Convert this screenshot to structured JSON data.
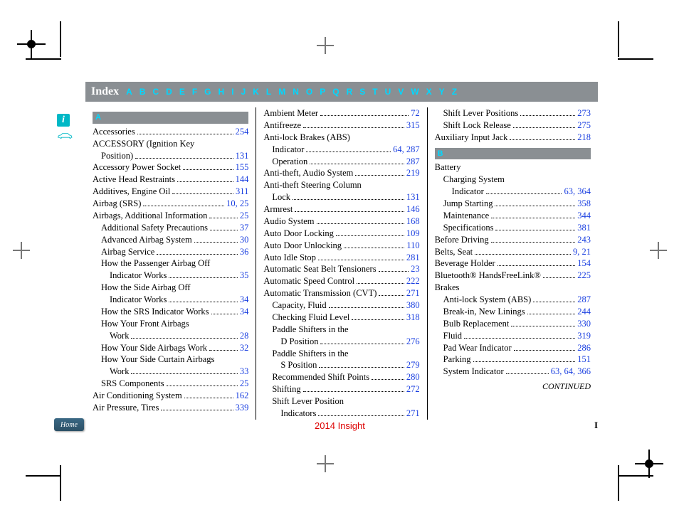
{
  "header": {
    "title": "Index",
    "letters": [
      "A",
      "B",
      "C",
      "D",
      "E",
      "F",
      "G",
      "H",
      "I",
      "J",
      "K",
      "L",
      "M",
      "N",
      "O",
      "P",
      "Q",
      "R",
      "S",
      "T",
      "U",
      "V",
      "W",
      "X",
      "Y",
      "Z"
    ]
  },
  "footer": {
    "center": "2014 Insight",
    "pageno": "I"
  },
  "side": {
    "info": "i",
    "home": "Home"
  },
  "continued": "CONTINUED",
  "sections": {
    "A": "A",
    "B": "B"
  },
  "col1": [
    {
      "t": "section",
      "k": "A"
    },
    {
      "t": "e",
      "l": "Accessories",
      "p": "254"
    },
    {
      "t": "e",
      "l": "ACCESSORY (Ignition Key",
      "noref": true
    },
    {
      "t": "e",
      "l": "Position)",
      "p": "131",
      "i": 1
    },
    {
      "t": "e",
      "l": "Accessory Power Socket",
      "p": "155"
    },
    {
      "t": "e",
      "l": "Active Head Restraints",
      "p": "144"
    },
    {
      "t": "e",
      "l": "Additives, Engine Oil",
      "p": "311"
    },
    {
      "t": "e",
      "l": "Airbag (SRS)",
      "p": "10, 25"
    },
    {
      "t": "e",
      "l": "Airbags, Additional Information",
      "p": "25"
    },
    {
      "t": "e",
      "l": "Additional Safety Precautions",
      "p": "37",
      "i": 1
    },
    {
      "t": "e",
      "l": "Advanced Airbag System",
      "p": "30",
      "i": 1
    },
    {
      "t": "e",
      "l": "Airbag Service",
      "p": "36",
      "i": 1
    },
    {
      "t": "e",
      "l": "How the Passenger Airbag Off",
      "noref": true,
      "i": 1
    },
    {
      "t": "e",
      "l": "Indicator Works",
      "p": "35",
      "i": 2
    },
    {
      "t": "e",
      "l": "How the Side Airbag Off",
      "noref": true,
      "i": 1
    },
    {
      "t": "e",
      "l": "Indicator Works",
      "p": "34",
      "i": 2
    },
    {
      "t": "e",
      "l": "How the SRS Indicator Works",
      "p": "34",
      "i": 1
    },
    {
      "t": "e",
      "l": "How Your Front Airbags",
      "noref": true,
      "i": 1
    },
    {
      "t": "e",
      "l": "Work",
      "p": "28",
      "i": 2
    },
    {
      "t": "e",
      "l": "How Your Side Airbags Work",
      "p": "32",
      "i": 1
    },
    {
      "t": "e",
      "l": "How Your Side Curtain Airbags",
      "noref": true,
      "i": 1
    },
    {
      "t": "e",
      "l": "Work",
      "p": "33",
      "i": 2
    },
    {
      "t": "e",
      "l": "SRS Components",
      "p": "25",
      "i": 1
    },
    {
      "t": "e",
      "l": "Air Conditioning System",
      "p": "162"
    },
    {
      "t": "e",
      "l": "Air Pressure, Tires",
      "p": "339"
    }
  ],
  "col2": [
    {
      "t": "e",
      "l": "Ambient Meter",
      "p": "72"
    },
    {
      "t": "e",
      "l": "Antifreeze",
      "p": "315"
    },
    {
      "t": "e",
      "l": "Anti-lock Brakes (ABS)",
      "noref": true
    },
    {
      "t": "e",
      "l": "Indicator",
      "p": "64, 287",
      "i": 1
    },
    {
      "t": "e",
      "l": "Operation",
      "p": "287",
      "i": 1
    },
    {
      "t": "e",
      "l": "Anti-theft, Audio System",
      "p": "219"
    },
    {
      "t": "e",
      "l": "Anti-theft Steering Column",
      "noref": true
    },
    {
      "t": "e",
      "l": "Lock",
      "p": "131",
      "i": 1
    },
    {
      "t": "e",
      "l": "Armrest",
      "p": "146"
    },
    {
      "t": "e",
      "l": "Audio System",
      "p": "168"
    },
    {
      "t": "e",
      "l": "Auto Door Locking",
      "p": "109"
    },
    {
      "t": "e",
      "l": "Auto Door Unlocking",
      "p": "110"
    },
    {
      "t": "e",
      "l": "Auto Idle Stop",
      "p": "281"
    },
    {
      "t": "e",
      "l": "Automatic Seat Belt Tensioners",
      "p": "23"
    },
    {
      "t": "e",
      "l": "Automatic Speed Control",
      "p": "222"
    },
    {
      "t": "e",
      "l": "Automatic Transmission (CVT)",
      "p": "271"
    },
    {
      "t": "e",
      "l": "Capacity, Fluid",
      "p": "380",
      "i": 1
    },
    {
      "t": "e",
      "l": "Checking Fluid Level",
      "p": "318",
      "i": 1
    },
    {
      "t": "e",
      "l": "Paddle Shifters in the",
      "noref": true,
      "i": 1
    },
    {
      "t": "e",
      "l": "D Position",
      "p": "276",
      "i": 2
    },
    {
      "t": "e",
      "l": "Paddle Shifters in the",
      "noref": true,
      "i": 1
    },
    {
      "t": "e",
      "l": "S Position",
      "p": "279",
      "i": 2
    },
    {
      "t": "e",
      "l": "Recommended Shift Points",
      "p": "280",
      "i": 1
    },
    {
      "t": "e",
      "l": "Shifting",
      "p": "272",
      "i": 1
    },
    {
      "t": "e",
      "l": "Shift Lever Position",
      "noref": true,
      "i": 1
    },
    {
      "t": "e",
      "l": "Indicators",
      "p": "271",
      "i": 2
    }
  ],
  "col3": [
    {
      "t": "e",
      "l": "Shift Lever Positions",
      "p": "273",
      "i": 1
    },
    {
      "t": "e",
      "l": "Shift Lock Release",
      "p": "275",
      "i": 1
    },
    {
      "t": "e",
      "l": "Auxiliary Input Jack",
      "p": "218"
    },
    {
      "t": "section",
      "k": "B"
    },
    {
      "t": "e",
      "l": "Battery",
      "noref": true
    },
    {
      "t": "e",
      "l": "Charging System",
      "noref": true,
      "i": 1
    },
    {
      "t": "e",
      "l": "Indicator",
      "p": "63, 364",
      "i": 2
    },
    {
      "t": "e",
      "l": "Jump Starting",
      "p": "358",
      "i": 1
    },
    {
      "t": "e",
      "l": "Maintenance",
      "p": "344",
      "i": 1
    },
    {
      "t": "e",
      "l": "Specifications",
      "p": "381",
      "i": 1
    },
    {
      "t": "e",
      "l": "Before Driving",
      "p": "243"
    },
    {
      "t": "e",
      "l": "Belts, Seat",
      "p": "9, 21"
    },
    {
      "t": "e",
      "l": "Beverage Holder",
      "p": "154"
    },
    {
      "t": "e",
      "l": "Bluetooth® HandsFreeLink®",
      "p": "225"
    },
    {
      "t": "e",
      "l": "Brakes",
      "noref": true
    },
    {
      "t": "e",
      "l": "Anti-lock System (ABS)",
      "p": "287",
      "i": 1
    },
    {
      "t": "e",
      "l": "Break-in, New Linings",
      "p": "244",
      "i": 1
    },
    {
      "t": "e",
      "l": "Bulb Replacement",
      "p": "330",
      "i": 1
    },
    {
      "t": "e",
      "l": "Fluid",
      "p": "319",
      "i": 1
    },
    {
      "t": "e",
      "l": "Pad Wear Indicator",
      "p": "286",
      "i": 1
    },
    {
      "t": "e",
      "l": "Parking",
      "p": "151",
      "i": 1
    },
    {
      "t": "e",
      "l": "System Indicator",
      "p": "63, 64, 366",
      "i": 1
    }
  ]
}
